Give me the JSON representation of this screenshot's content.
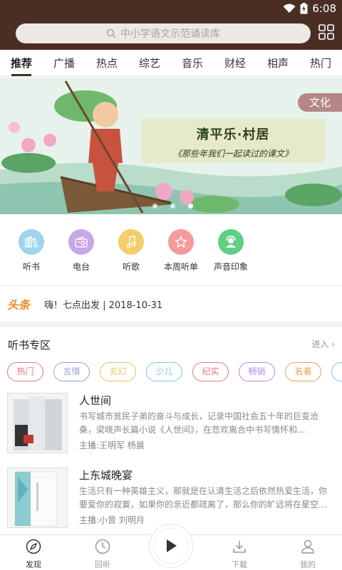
{
  "status": {
    "time": "6:08"
  },
  "search": {
    "placeholder": "中小学语文示范诵读库"
  },
  "tabs": [
    {
      "label": "推荐",
      "active": true
    },
    {
      "label": "广播"
    },
    {
      "label": "热点"
    },
    {
      "label": "综艺"
    },
    {
      "label": "音乐"
    },
    {
      "label": "财经"
    },
    {
      "label": "相声"
    },
    {
      "label": "热门"
    }
  ],
  "banner": {
    "badge": "文化",
    "title": "清平乐·村居",
    "subtitle": "《那些年我们一起读过的课文》"
  },
  "quick": [
    {
      "label": "听书",
      "color": "#9fd3ee",
      "icon": "books-icon"
    },
    {
      "label": "电台",
      "color": "#c8a7e6",
      "icon": "radio-icon"
    },
    {
      "label": "听歌",
      "color": "#f5cd6a",
      "icon": "music-note-icon"
    },
    {
      "label": "本周听单",
      "color": "#f59a9a",
      "icon": "star-icon"
    },
    {
      "label": "声音印象",
      "color": "#5fcf84",
      "icon": "user-voice-icon"
    }
  ],
  "news": {
    "logo": "头条",
    "text": "嗨！七点出发 | 2018-10-31"
  },
  "section": {
    "title": "听书专区",
    "more": "进入"
  },
  "tags": [
    {
      "label": "热门",
      "color": "#e87b7b"
    },
    {
      "label": "言情",
      "color": "#8fa4e0"
    },
    {
      "label": "玄幻",
      "color": "#e8c35a"
    },
    {
      "label": "少儿",
      "color": "#7cc6e6"
    },
    {
      "label": "纪实",
      "color": "#e87b7b"
    },
    {
      "label": "畅销",
      "color": "#b08fe0"
    },
    {
      "label": "名著",
      "color": "#e8a24a"
    },
    {
      "label": "",
      "color": "#7cc6e6"
    }
  ],
  "books": [
    {
      "title": "人世间",
      "desc": "书写城市贫民子弟的奋斗与成长，记录中国社会五十年的巨变沧桑，梁晓声长篇小说《人世间》，在悲欢离合中书写情怀和...",
      "anchor": "主播:王明军 杨晨"
    },
    {
      "title": "上东城晚宴",
      "desc": "生活只有一种英雄主义，那就是在认清生活之后依然热爱生活，你要爱你的寂寞，如果你的亲近都疏离了，那么你的旷远将在星空...",
      "anchor": "主播:小曾 刘明月"
    }
  ],
  "nav": [
    {
      "label": "发现",
      "active": true
    },
    {
      "label": "回听"
    },
    {
      "label": "下载"
    },
    {
      "label": "我的"
    }
  ]
}
